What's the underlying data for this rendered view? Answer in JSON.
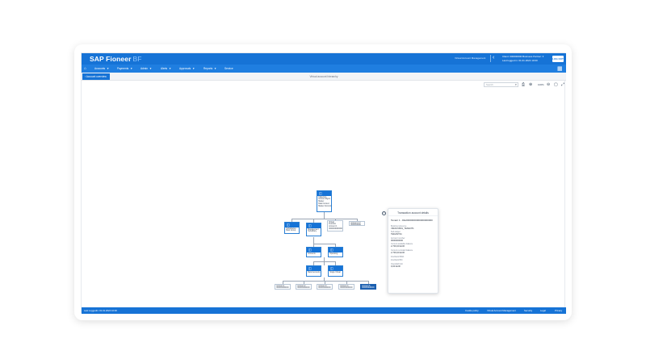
{
  "header": {
    "brand": "SAP Fioneer",
    "brand_suffix": "BF",
    "links": [
      "Virtual Account Management"
    ],
    "back_icon": "chevron-left-icon",
    "account_line1": "Client: 000000000   Business Partner: ▾",
    "account_line2": "Last logged in: 01.01.2024 10:00",
    "logout_label": "LOG OUT"
  },
  "nav": {
    "home_icon": "home-icon",
    "items": [
      "Accounts",
      "Payments",
      "Admin",
      "Alerts",
      "Approvals",
      "Reports",
      "Service"
    ],
    "grid_icon": "grid-icon"
  },
  "subbar": {
    "back_label": "Account overview",
    "page_title": "Virtual account hierarchy"
  },
  "toolbar": {
    "search_placeholder": "Search",
    "zoom_level": "100%"
  },
  "tree": {
    "root": "Collection\nAccount Mgmt\nMaster\nData Context\nMaster Account",
    "level1": [
      "Subsidiaries\nMain Group",
      "Management\nSubsidiary",
      "Virtual\nFunction\nAccount 1\n0000000000000",
      "Account 2 V\n0000000000"
    ],
    "level2": [
      "Accounts",
      "Operating"
    ],
    "level3": [
      "Bank Accounts",
      "Single Virtual"
    ],
    "level4": [
      "Account 1\n000000000000",
      "Account 2\n000000000000",
      "Account 3\n000000000000",
      "Account 4\n000000000000",
      "Account 5\n000000000000"
    ]
  },
  "popover": {
    "title": "Transaction account details",
    "heading": "Tenant 1 - DE20000000000000000000",
    "rows": [
      {
        "label": "Booking reference",
        "value": "VIRACCB01_TENANT1"
      },
      {
        "label": "Sub-ledger",
        "value": "TENANT01"
      },
      {
        "label": "Account number",
        "value": "0000000000"
      },
      {
        "label": "Current available balance",
        "value": "2.700,00 EUR"
      },
      {
        "label": "Current recorded balance",
        "value": "2.700,00 EUR"
      },
      {
        "label": "Interbank IBAN",
        "value": ""
      },
      {
        "label": "Interbank BIC",
        "value": ""
      },
      {
        "label": "Overdraft limit",
        "value": "0,00 EUR"
      }
    ]
  },
  "footer": {
    "last_login": "Last Loggedin: 01.01.2024 10:00",
    "links": [
      "Cookie policy",
      "Virtual Account Management",
      "Security",
      "Legal",
      "Privacy"
    ]
  },
  "colors": {
    "primary": "#1673d6",
    "nav": "#1f7ee0",
    "selected": "#1b5fb0"
  }
}
